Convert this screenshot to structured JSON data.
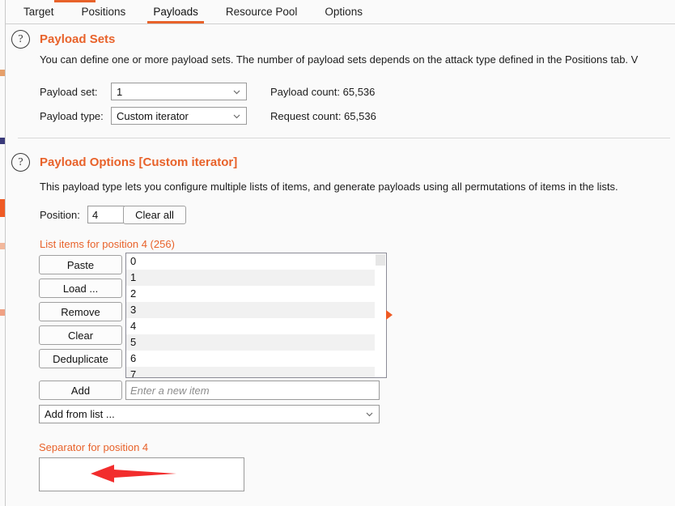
{
  "window": {
    "background": "#fafafa",
    "accent": "#e8622a",
    "annotation_color": "#f22d2d"
  },
  "tabs": [
    {
      "label": "Target",
      "active": false
    },
    {
      "label": "Positions",
      "active": false
    },
    {
      "label": "Payloads",
      "active": true
    },
    {
      "label": "Resource Pool",
      "active": false
    },
    {
      "label": "Options",
      "active": false
    }
  ],
  "payload_sets": {
    "help_icon": "question-mark-icon",
    "title": "Payload Sets",
    "description": "You can define one or more payload sets. The number of payload sets depends on the attack type defined in the Positions tab. V",
    "payload_set_label": "Payload set:",
    "payload_set_value": "1",
    "payload_type_label": "Payload type:",
    "payload_type_value": "Custom iterator",
    "payload_count_label": "Payload count: 65,536",
    "request_count_label": "Request count: 65,536"
  },
  "payload_options": {
    "help_icon": "question-mark-icon",
    "title": "Payload Options [Custom iterator]",
    "description": "This payload type lets you configure multiple lists of items, and generate payloads using all permutations of items in the lists.",
    "position_label": "Position:",
    "position_value": "4",
    "clear_all_label": "Clear all",
    "list_heading": "List items for position 4 (256)",
    "list_buttons": [
      "Paste",
      "Load ...",
      "Remove",
      "Clear",
      "Deduplicate"
    ],
    "list_items": [
      "0",
      "1",
      "2",
      "3",
      "4",
      "5",
      "6",
      "7"
    ],
    "add_label": "Add",
    "add_placeholder": "Enter a new item",
    "add_value": "",
    "add_from_list_value": "Add from list ...",
    "separator_heading": "Separator for position 4",
    "separator_value": ""
  }
}
